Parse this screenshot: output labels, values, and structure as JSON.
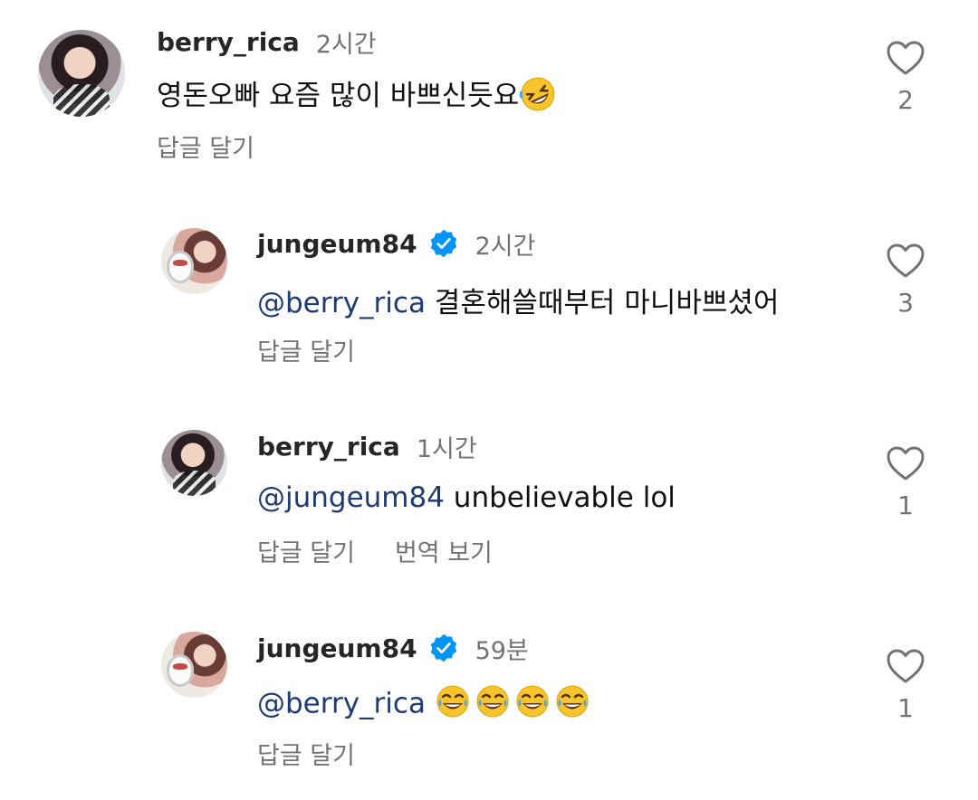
{
  "comments": [
    {
      "user": "berry_rica",
      "time": "2시간",
      "verified": false,
      "mention": "",
      "text": "영돈오빠 요즘 많이 바쁘신듯요",
      "emoji": [
        "rofl"
      ],
      "actions": [
        "답글 달기"
      ],
      "likes": "2"
    },
    {
      "user": "jungeum84",
      "time": "2시간",
      "verified": true,
      "mention": "@berry_rica",
      "text": " 결혼해쓸때부터 마니바쁘셨어",
      "emoji": [],
      "actions": [
        "답글 달기"
      ],
      "likes": "3"
    },
    {
      "user": "berry_rica",
      "time": "1시간",
      "verified": false,
      "mention": "@jungeum84",
      "text": " unbelievable lol",
      "emoji": [],
      "actions": [
        "답글 달기",
        "번역 보기"
      ],
      "likes": "1"
    },
    {
      "user": "jungeum84",
      "time": "59분",
      "verified": true,
      "mention": "@berry_rica",
      "text": " ",
      "emoji": [
        "tears-of-joy",
        "tears-of-joy",
        "tears-of-joy",
        "tears-of-joy"
      ],
      "actions": [
        "답글 달기"
      ],
      "likes": "1"
    }
  ],
  "colors": {
    "verified_badge": "#0095f6",
    "mention": "#1f3b73",
    "secondary_text": "#737373"
  }
}
